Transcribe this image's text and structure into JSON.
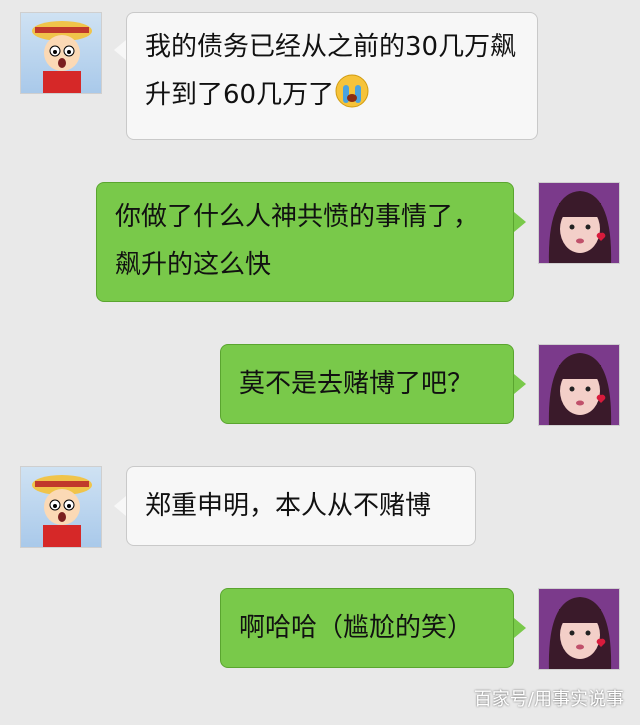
{
  "chat": {
    "messages": [
      {
        "side": "in",
        "text": "我的债务已经从之前的30几万飙升到了60几万了",
        "emoji": "crying-face-icon"
      },
      {
        "side": "out",
        "text": "你做了什么人神共愤的事情了，飙升的这么快"
      },
      {
        "side": "out",
        "text": "莫不是去赌博了吧？"
      },
      {
        "side": "in",
        "text": "郑重申明，本人从不赌博"
      },
      {
        "side": "out",
        "text": "啊哈哈（尴尬的笑）"
      }
    ]
  },
  "watermark": "百家号/用事实说事",
  "colors": {
    "background": "#e9e9e9",
    "incoming_bubble": "#f7f7f7",
    "outgoing_bubble": "#79c94a"
  }
}
